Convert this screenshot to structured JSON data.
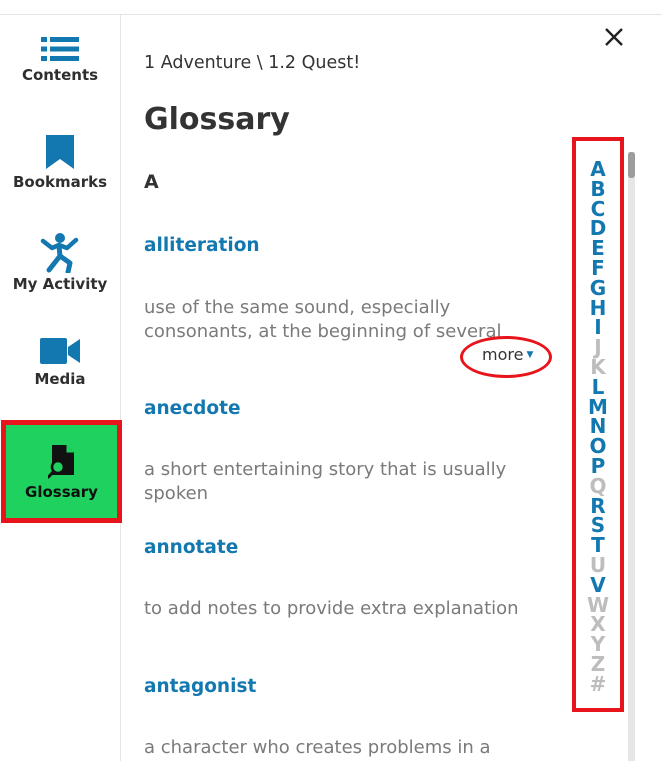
{
  "sidebar": {
    "items": [
      {
        "label": "Contents",
        "icon": "list-icon"
      },
      {
        "label": "Bookmarks",
        "icon": "bookmark-icon"
      },
      {
        "label": "My Activity",
        "icon": "activity-person-icon"
      },
      {
        "label": "Media",
        "icon": "video-camera-icon"
      },
      {
        "label": "Glossary",
        "icon": "glossary-search-icon",
        "active": true
      }
    ]
  },
  "header": {
    "breadcrumb": "1 Adventure \\ 1.2 Quest!",
    "title": "Glossary",
    "close_icon": "close-icon"
  },
  "glossary": {
    "letter": "A",
    "entries": [
      {
        "term": "alliteration",
        "definition": "use of the same sound, especially consonants, at the beginning of several"
      },
      {
        "term": "anecdote",
        "definition": "a short entertaining story that is usually spoken"
      },
      {
        "term": "annotate",
        "definition": "to add notes to provide extra explanation"
      },
      {
        "term": "antagonist",
        "definition": "a character who creates problems in a"
      }
    ],
    "more_label": "more",
    "more_caret": "▼"
  },
  "alphabet": [
    {
      "letter": "A",
      "enabled": true
    },
    {
      "letter": "B",
      "enabled": true
    },
    {
      "letter": "C",
      "enabled": true
    },
    {
      "letter": "D",
      "enabled": true
    },
    {
      "letter": "E",
      "enabled": true
    },
    {
      "letter": "F",
      "enabled": true
    },
    {
      "letter": "G",
      "enabled": true
    },
    {
      "letter": "H",
      "enabled": true
    },
    {
      "letter": "I",
      "enabled": true
    },
    {
      "letter": "J",
      "enabled": false
    },
    {
      "letter": "K",
      "enabled": false
    },
    {
      "letter": "L",
      "enabled": true
    },
    {
      "letter": "M",
      "enabled": true
    },
    {
      "letter": "N",
      "enabled": true
    },
    {
      "letter": "O",
      "enabled": true
    },
    {
      "letter": "P",
      "enabled": true
    },
    {
      "letter": "Q",
      "enabled": false
    },
    {
      "letter": "R",
      "enabled": true
    },
    {
      "letter": "S",
      "enabled": true
    },
    {
      "letter": "T",
      "enabled": true
    },
    {
      "letter": "U",
      "enabled": false
    },
    {
      "letter": "V",
      "enabled": true
    },
    {
      "letter": "W",
      "enabled": false
    },
    {
      "letter": "X",
      "enabled": false
    },
    {
      "letter": "Y",
      "enabled": false
    },
    {
      "letter": "Z",
      "enabled": false
    },
    {
      "letter": "#",
      "enabled": false
    }
  ],
  "colors": {
    "accent": "#1478b0",
    "active_bg": "#1fd15f",
    "highlight": "#e8141b",
    "disabled": "#bdbdbd"
  }
}
